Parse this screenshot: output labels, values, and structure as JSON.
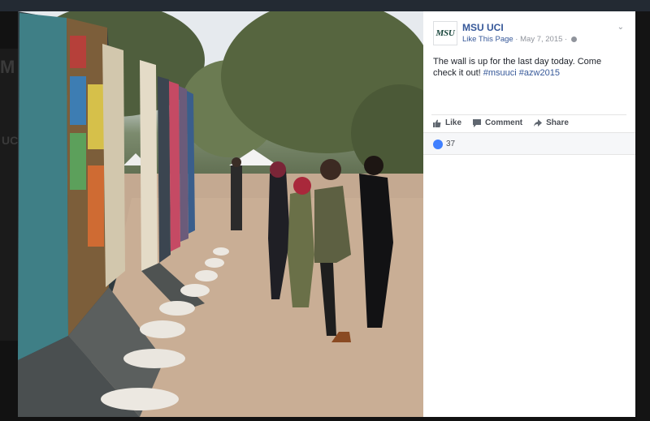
{
  "page": {
    "name": "MSU UCI",
    "avatar_text": "MSU",
    "like_page_label": "Like This Page",
    "separator": " · ",
    "date": "May 7, 2015",
    "separator2": " · "
  },
  "post": {
    "text": "The wall is up for the last day today. Come check it out!",
    "hashtags": [
      "#msuuci",
      "#azw2015"
    ]
  },
  "actions": {
    "like_label": "Like",
    "comment_label": "Comment",
    "share_label": "Share"
  },
  "reactions": {
    "count": "37"
  },
  "background_text": {
    "left_1": "M",
    "left_2": "UC"
  },
  "colors": {
    "link_blue": "#365899",
    "like_blue": "#4080ff",
    "text": "#1d2129",
    "muted": "#90949c"
  },
  "icons": [
    "globe-icon",
    "chevron-down-icon",
    "thumbs-up-icon",
    "comment-icon",
    "share-icon",
    "like-reaction-icon"
  ]
}
